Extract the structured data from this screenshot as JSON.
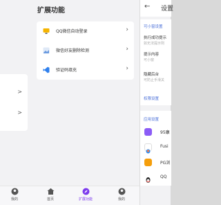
{
  "main": {
    "title": "扩展功能",
    "features": [
      {
        "label": "QQ微信自动登录",
        "icon": "monitor-icon"
      },
      {
        "label": "微信好友删除检测",
        "icon": "image-icon"
      },
      {
        "label": "验证码填充",
        "icon": "vscode-icon"
      }
    ]
  },
  "nav": {
    "items": [
      {
        "label": "我的"
      },
      {
        "label": "首页"
      },
      {
        "label": "扩展功能"
      },
      {
        "label": "我的"
      }
    ]
  },
  "settings": {
    "title": "设置",
    "section_small_window": "可小窗设置",
    "execute_title": "执行成功提示",
    "execute_sub": "如无法提示则",
    "tip_title": "提示内容",
    "tip_sub": "可小窗",
    "hide_title": "隐藏后台",
    "hide_sub": "可防止手滑关",
    "section_permission": "权限设置",
    "section_app": "应用设置",
    "apps": [
      {
        "name": "95康"
      },
      {
        "name": "Fusi"
      },
      {
        "name": "PG浏"
      },
      {
        "name": "QQ"
      }
    ]
  },
  "colors": {
    "accent": "#7c3aed",
    "section_blue": "#4a6fd8"
  }
}
